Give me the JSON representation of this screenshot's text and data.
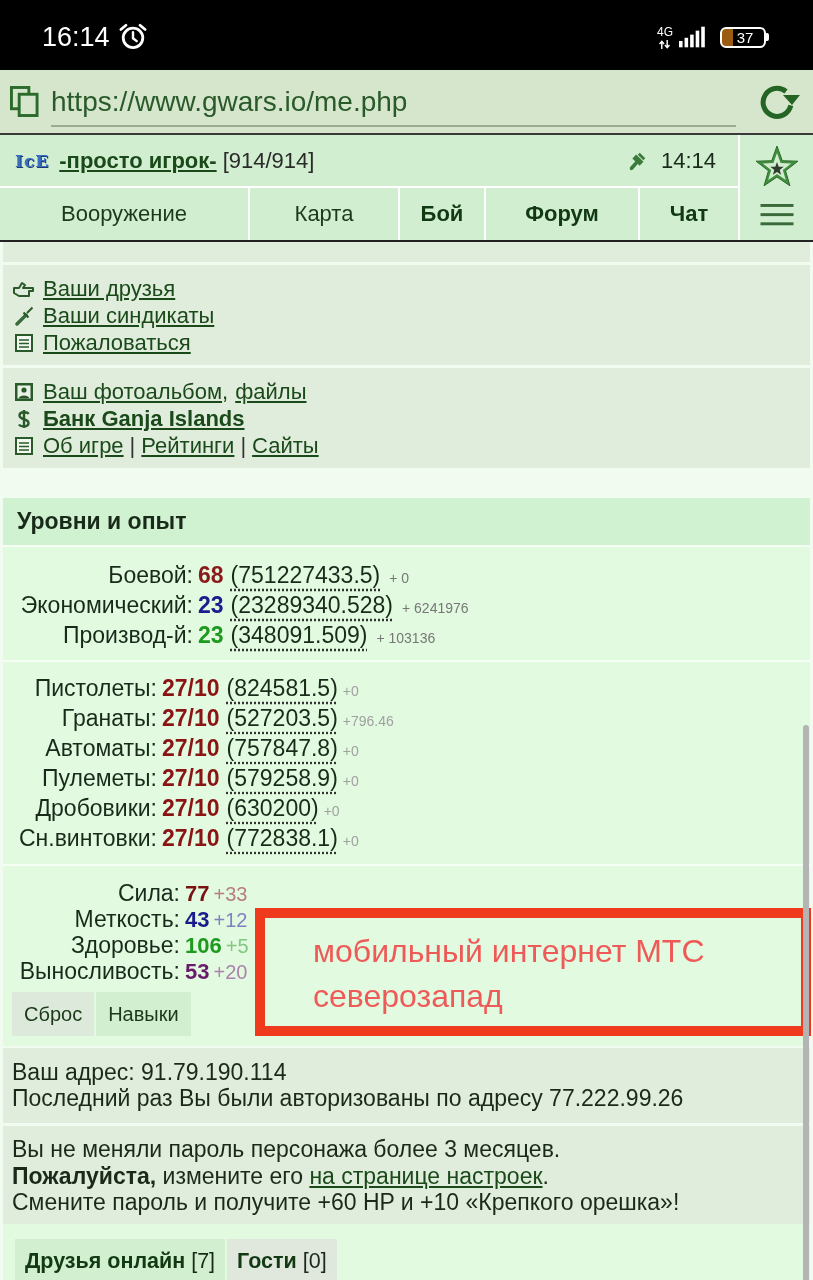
{
  "status_bar": {
    "time": "16:14",
    "network": "4G",
    "battery": "37"
  },
  "browser": {
    "url": "https://www.gwars.io/me.php"
  },
  "header": {
    "logo": "IcE",
    "nickname": "-просто игрок-",
    "hp": "[914/914]",
    "server_time": "14:14",
    "nav": [
      {
        "label": "Вооружение",
        "bold": false
      },
      {
        "label": "Карта",
        "bold": false
      },
      {
        "label": "Бой",
        "bold": true
      },
      {
        "label": "Форум",
        "bold": true
      },
      {
        "label": "Чат",
        "bold": true
      }
    ]
  },
  "link_panels": [
    {
      "items": [
        {
          "parts": [
            {
              "kind": "link",
              "text": "Ваши друзья",
              "bold": false
            }
          ]
        },
        {
          "parts": [
            {
              "kind": "link",
              "text": "Ваши синдикаты",
              "bold": false
            }
          ]
        },
        {
          "parts": [
            {
              "kind": "link",
              "text": "Пожаловаться",
              "bold": false
            }
          ]
        }
      ]
    },
    {
      "items": [
        {
          "parts": [
            {
              "kind": "link",
              "text": "Ваш фотоальбом",
              "bold": false
            },
            {
              "kind": "comma",
              "text": ","
            },
            {
              "kind": "link",
              "text": "файлы",
              "bold": false
            }
          ]
        },
        {
          "parts": [
            {
              "kind": "link",
              "text": "Банк Ganja Islands",
              "bold": true
            }
          ]
        },
        {
          "parts": [
            {
              "kind": "link",
              "text": "Об игре",
              "bold": false
            },
            {
              "kind": "pipe",
              "text": "|"
            },
            {
              "kind": "link",
              "text": "Рейтинги",
              "bold": false
            },
            {
              "kind": "pipe",
              "text": "|"
            },
            {
              "kind": "link",
              "text": "Сайты",
              "bold": false
            }
          ]
        }
      ]
    }
  ],
  "levels": {
    "title": "Уровни и опыт",
    "main": [
      {
        "label": "Боевой:",
        "value": "68",
        "exp": "(751227433.5)",
        "gain": "+ 0",
        "color": "#8b1a1a"
      },
      {
        "label": "Экономический:",
        "value": "23",
        "exp": "(23289340.528)",
        "gain": "+ 6241976",
        "color": "#1c1c8c"
      },
      {
        "label": "Производ-й:",
        "value": "23",
        "exp": "(348091.509)",
        "gain": "+ 103136",
        "color": "#1e9a1e"
      }
    ],
    "skills": [
      {
        "label": "Пистолеты:",
        "value": "27/10",
        "exp": "(824581.5)",
        "gain": "+0"
      },
      {
        "label": "Гранаты:",
        "value": "27/10",
        "exp": "(527203.5)",
        "gain": "+796.46"
      },
      {
        "label": "Автоматы:",
        "value": "27/10",
        "exp": "(757847.8)",
        "gain": "+0"
      },
      {
        "label": "Пулеметы:",
        "value": "27/10",
        "exp": "(579258.9)",
        "gain": "+0"
      },
      {
        "label": "Дробовики:",
        "value": "27/10",
        "exp": "(630200)",
        "gain": "+0"
      },
      {
        "label": "Сн.винтовки:",
        "value": "27/10",
        "exp": "(772838.1)",
        "gain": "+0"
      }
    ],
    "stats": [
      {
        "label": "Сила:",
        "value": "77",
        "bonus": "+33",
        "color": "#7a1212"
      },
      {
        "label": "Меткость:",
        "value": "43",
        "bonus": "+12",
        "color": "#1a1a8a"
      },
      {
        "label": "Здоровье:",
        "value": "106",
        "bonus": "+5",
        "color": "#1e9a1e"
      },
      {
        "label": "Выносливость:",
        "value": "53",
        "bonus": "+20",
        "color": "#6a1a6a"
      }
    ],
    "buttons": [
      {
        "label": "Сброс"
      },
      {
        "label": "Навыки"
      }
    ]
  },
  "address": {
    "lines": [
      "Ваш адрес: 91.79.190.114",
      "Последний раз Вы были авторизованы по адресу 77.222.99.26"
    ]
  },
  "password_notice": {
    "first": "Вы не меняли пароль персонажа более 3 месяцев.",
    "before": "**Пожалуйста,** измените его",
    "link": "на странице настроек",
    "after": ".",
    "last": "Смените пароль и получите +60 HP и +10 «Крепкого орешка»!"
  },
  "friends_tabs": [
    {
      "label": "Друзья онлайн",
      "count": "[7]",
      "selected": true
    },
    {
      "label": "Гости",
      "count": "[0]",
      "selected": false
    }
  ],
  "annotation": {
    "text": "мобильный интернет МТС северозапад"
  }
}
